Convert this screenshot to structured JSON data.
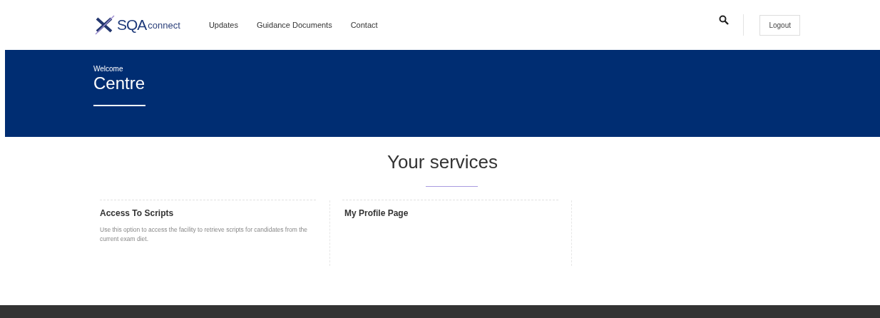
{
  "header": {
    "logo": {
      "brand": "SQA",
      "product": "connect"
    },
    "nav": [
      {
        "label": "Updates"
      },
      {
        "label": "Guidance Documents"
      },
      {
        "label": "Contact"
      }
    ],
    "logout": "Logout"
  },
  "banner": {
    "greeting": "Welcome",
    "title": "Centre"
  },
  "services": {
    "heading": "Your services",
    "cards": [
      {
        "title": "Access To Scripts",
        "description": "Use this option to access the facility to retrieve scripts for candidates from the current exam diet."
      },
      {
        "title": "My Profile Page"
      }
    ]
  }
}
